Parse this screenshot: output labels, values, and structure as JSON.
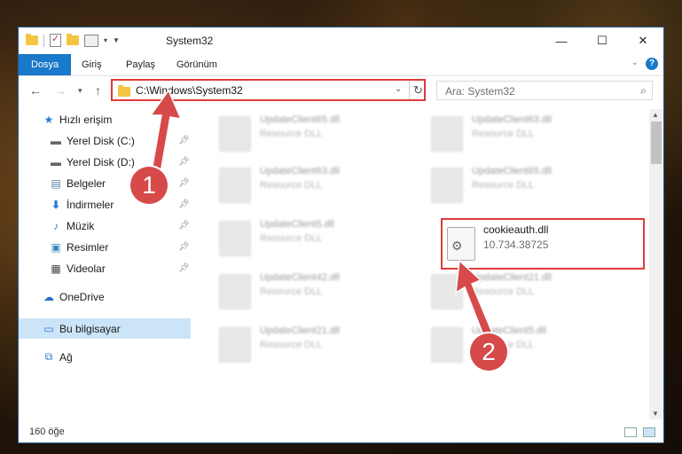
{
  "window": {
    "title": "System32",
    "controls": {
      "minimize": "—",
      "maximize": "☐",
      "close": "✕"
    }
  },
  "ribbon": {
    "tabs": [
      "Dosya",
      "Giriş",
      "Paylaş",
      "Görünüm"
    ],
    "help": "?"
  },
  "nav": {
    "address": "C:\\Windows\\System32",
    "search_placeholder": "Ara: System32"
  },
  "sidebar": {
    "items": [
      {
        "label": "Hızlı erişim",
        "icon": "star-icon",
        "pinned": false
      },
      {
        "label": "Yerel Disk (C:)",
        "icon": "drive-icon",
        "pinned": true
      },
      {
        "label": "Yerel Disk (D:)",
        "icon": "drive-icon",
        "pinned": true
      },
      {
        "label": "Belgeler",
        "icon": "documents-icon",
        "pinned": true
      },
      {
        "label": "İndirmeler",
        "icon": "download-icon",
        "pinned": true
      },
      {
        "label": "Müzik",
        "icon": "music-icon",
        "pinned": true
      },
      {
        "label": "Resimler",
        "icon": "pictures-icon",
        "pinned": true
      },
      {
        "label": "Videolar",
        "icon": "videos-icon",
        "pinned": true
      },
      {
        "label": "OneDrive",
        "icon": "onedrive-icon",
        "pinned": false
      },
      {
        "label": "Bu bilgisayar",
        "icon": "computer-icon",
        "pinned": false,
        "selected": true
      },
      {
        "label": "Ağ",
        "icon": "network-icon",
        "pinned": false
      }
    ]
  },
  "files": [
    {
      "name": "UpdateClient65.dll",
      "type": "Resource DLL"
    },
    {
      "name": "UpdateClient63.dll",
      "type": "Resource DLL"
    },
    {
      "name": "UpdateClient63.dll",
      "type": "Resource DLL"
    },
    {
      "name": "UpdateClient65.dll",
      "type": "Resource DLL"
    },
    {
      "name": "UpdateClient5.dll",
      "type": "Resource DLL"
    },
    {
      "name": "cookieauth.dll",
      "type": "10.734.38725",
      "highlighted": true
    },
    {
      "name": "UpdateClient42.dll",
      "type": "Resource DLL"
    },
    {
      "name": "UpdateClient21.dll",
      "type": "Resource DLL"
    },
    {
      "name": "UpdateClient21.dll",
      "type": "Resource DLL"
    },
    {
      "name": "UpdateClient5.dll",
      "type": "Resource DLL"
    }
  ],
  "status": {
    "count": "160 öğe"
  },
  "annotations": {
    "badge1": "1",
    "badge2": "2"
  },
  "colors": {
    "accent": "#1979ca",
    "highlight": "#e03a3a",
    "badge": "#d64a4a",
    "selected": "#cce4f7"
  }
}
